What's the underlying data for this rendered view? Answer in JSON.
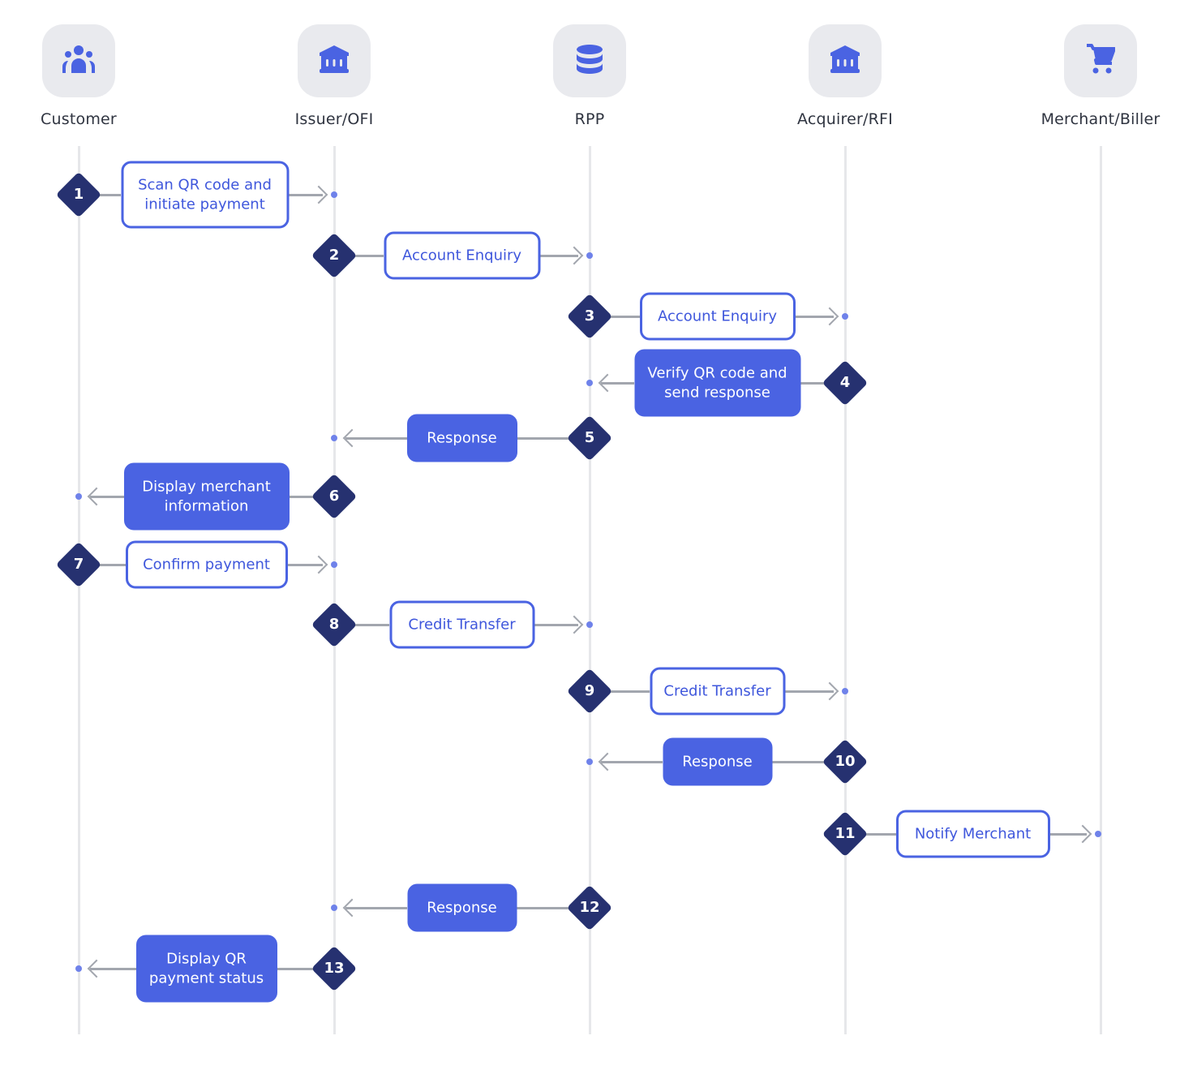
{
  "colors": {
    "accent": "#4a63e2",
    "diamond": "#263170",
    "tile": "#e9eaee",
    "connector": "#a2a6ae",
    "lifeline": "#e6e7ea"
  },
  "participants": [
    {
      "name": "Customer",
      "icon": "people-icon"
    },
    {
      "name": "Issuer/OFI",
      "icon": "bank-icon"
    },
    {
      "name": "RPP",
      "icon": "database-icon"
    },
    {
      "name": "Acquirer/RFI",
      "icon": "bank-icon"
    },
    {
      "name": "Merchant/Biller",
      "icon": "cart-icon"
    }
  ],
  "steps": [
    {
      "num": "1",
      "from": 0,
      "to": 1,
      "label": "Scan QR code and\ninitiate payment",
      "style": "outline"
    },
    {
      "num": "2",
      "from": 1,
      "to": 2,
      "label": "Account Enquiry",
      "style": "outline"
    },
    {
      "num": "3",
      "from": 2,
      "to": 3,
      "label": "Account Enquiry",
      "style": "outline"
    },
    {
      "num": "4",
      "from": 3,
      "to": 2,
      "label": "Verify QR code and\nsend response",
      "style": "filled"
    },
    {
      "num": "5",
      "from": 2,
      "to": 1,
      "label": "Response",
      "style": "filled"
    },
    {
      "num": "6",
      "from": 1,
      "to": 0,
      "label": "Display merchant\ninformation",
      "style": "filled"
    },
    {
      "num": "7",
      "from": 0,
      "to": 1,
      "label": "Confirm payment",
      "style": "outline"
    },
    {
      "num": "8",
      "from": 1,
      "to": 2,
      "label": "Credit Transfer",
      "style": "outline"
    },
    {
      "num": "9",
      "from": 2,
      "to": 3,
      "label": "Credit Transfer",
      "style": "outline"
    },
    {
      "num": "10",
      "from": 3,
      "to": 2,
      "label": "Response",
      "style": "filled"
    },
    {
      "num": "11",
      "from": 3,
      "to": 4,
      "label": "Notify Merchant",
      "style": "outline"
    },
    {
      "num": "12",
      "from": 2,
      "to": 1,
      "label": "Response",
      "style": "filled"
    },
    {
      "num": "13",
      "from": 1,
      "to": 0,
      "label": "Display QR\npayment status",
      "style": "filled"
    }
  ]
}
